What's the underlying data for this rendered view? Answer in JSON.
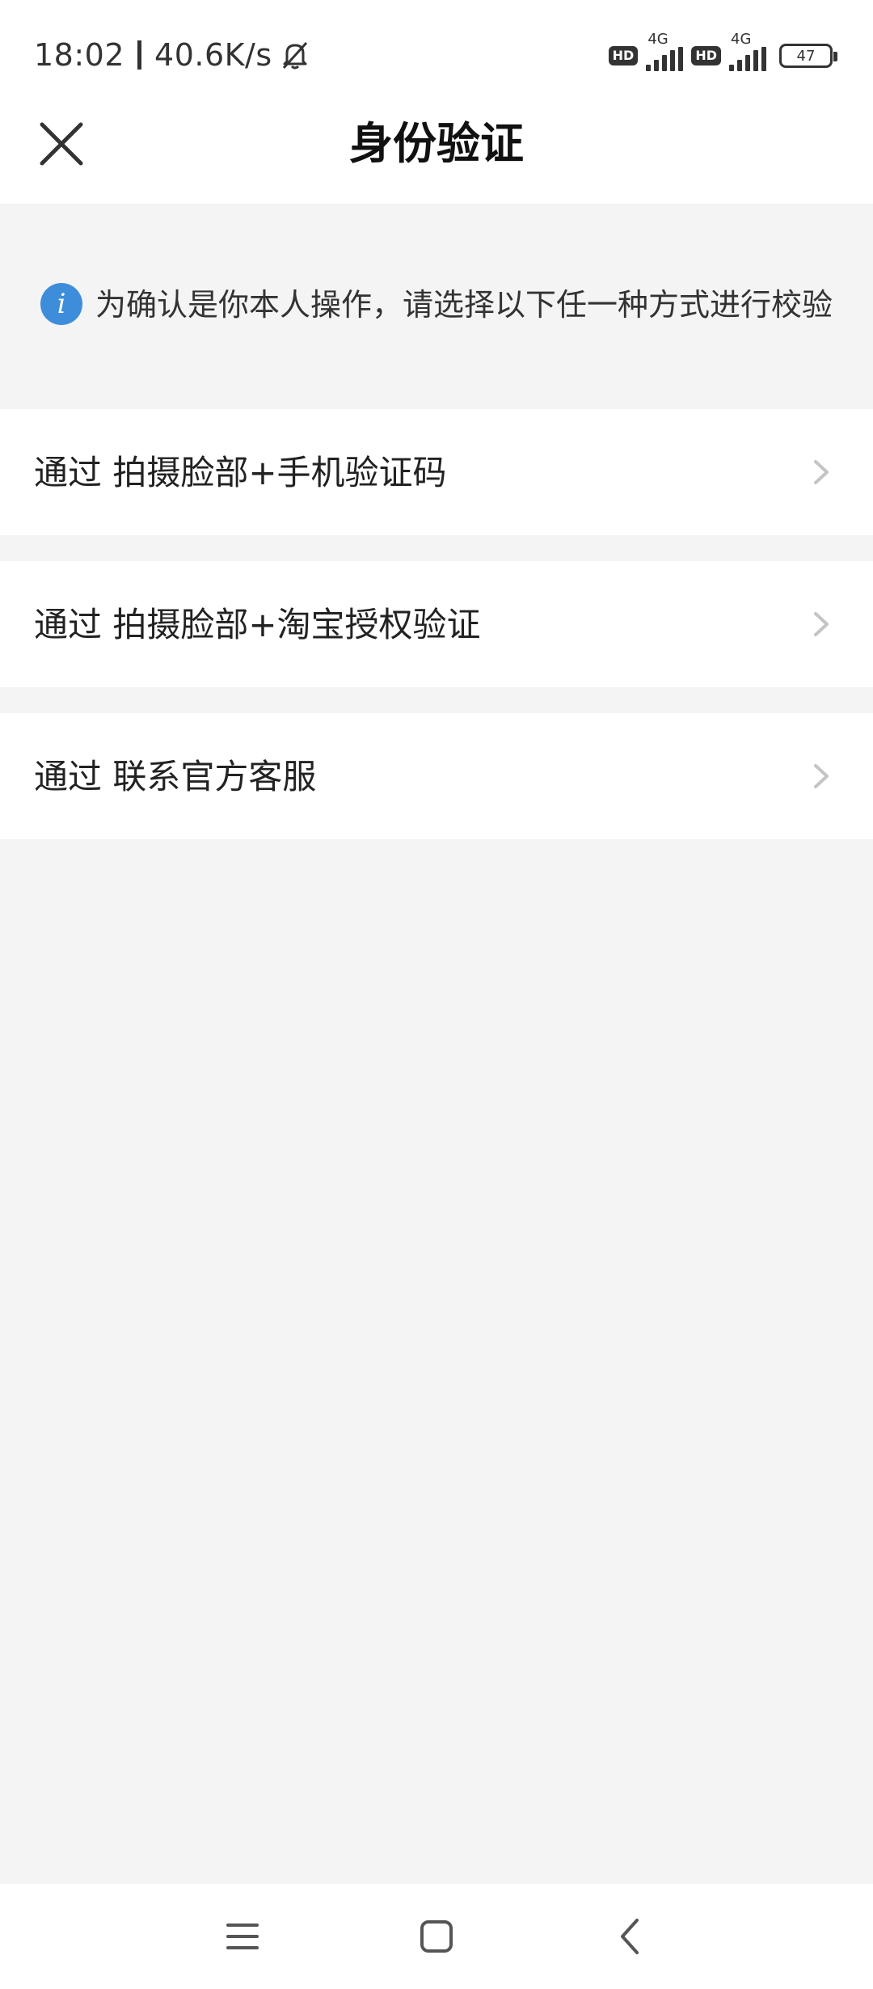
{
  "status_bar": {
    "time": "18:02",
    "net_speed": "40.6K/s",
    "sim1": {
      "hd": "HD",
      "network": "4G"
    },
    "sim2": {
      "hd": "HD",
      "network": "4G"
    },
    "battery": "47",
    "icons": [
      "bell-mute-icon",
      "signal-icon",
      "battery-icon"
    ]
  },
  "header": {
    "title": "身份验证",
    "close_icon": "close-icon"
  },
  "notice": {
    "icon": "info-icon",
    "icon_glyph": "i",
    "text": "为确认是你本人操作，请选择以下任一种方式进行校验"
  },
  "options": [
    {
      "label": "通过 拍摄脸部+手机验证码",
      "icon": "chevron-right-icon"
    },
    {
      "label": "通过 拍摄脸部+淘宝授权验证",
      "icon": "chevron-right-icon"
    },
    {
      "label": "通过 联系官方客服",
      "icon": "chevron-right-icon"
    }
  ],
  "nav_bar": {
    "icons": [
      "menu-icon",
      "home-icon",
      "back-icon"
    ]
  },
  "colors": {
    "accent": "#3d8ddb",
    "background": "#f4f4f4",
    "surface": "#ffffff",
    "chevron": "#c4c4c4"
  }
}
